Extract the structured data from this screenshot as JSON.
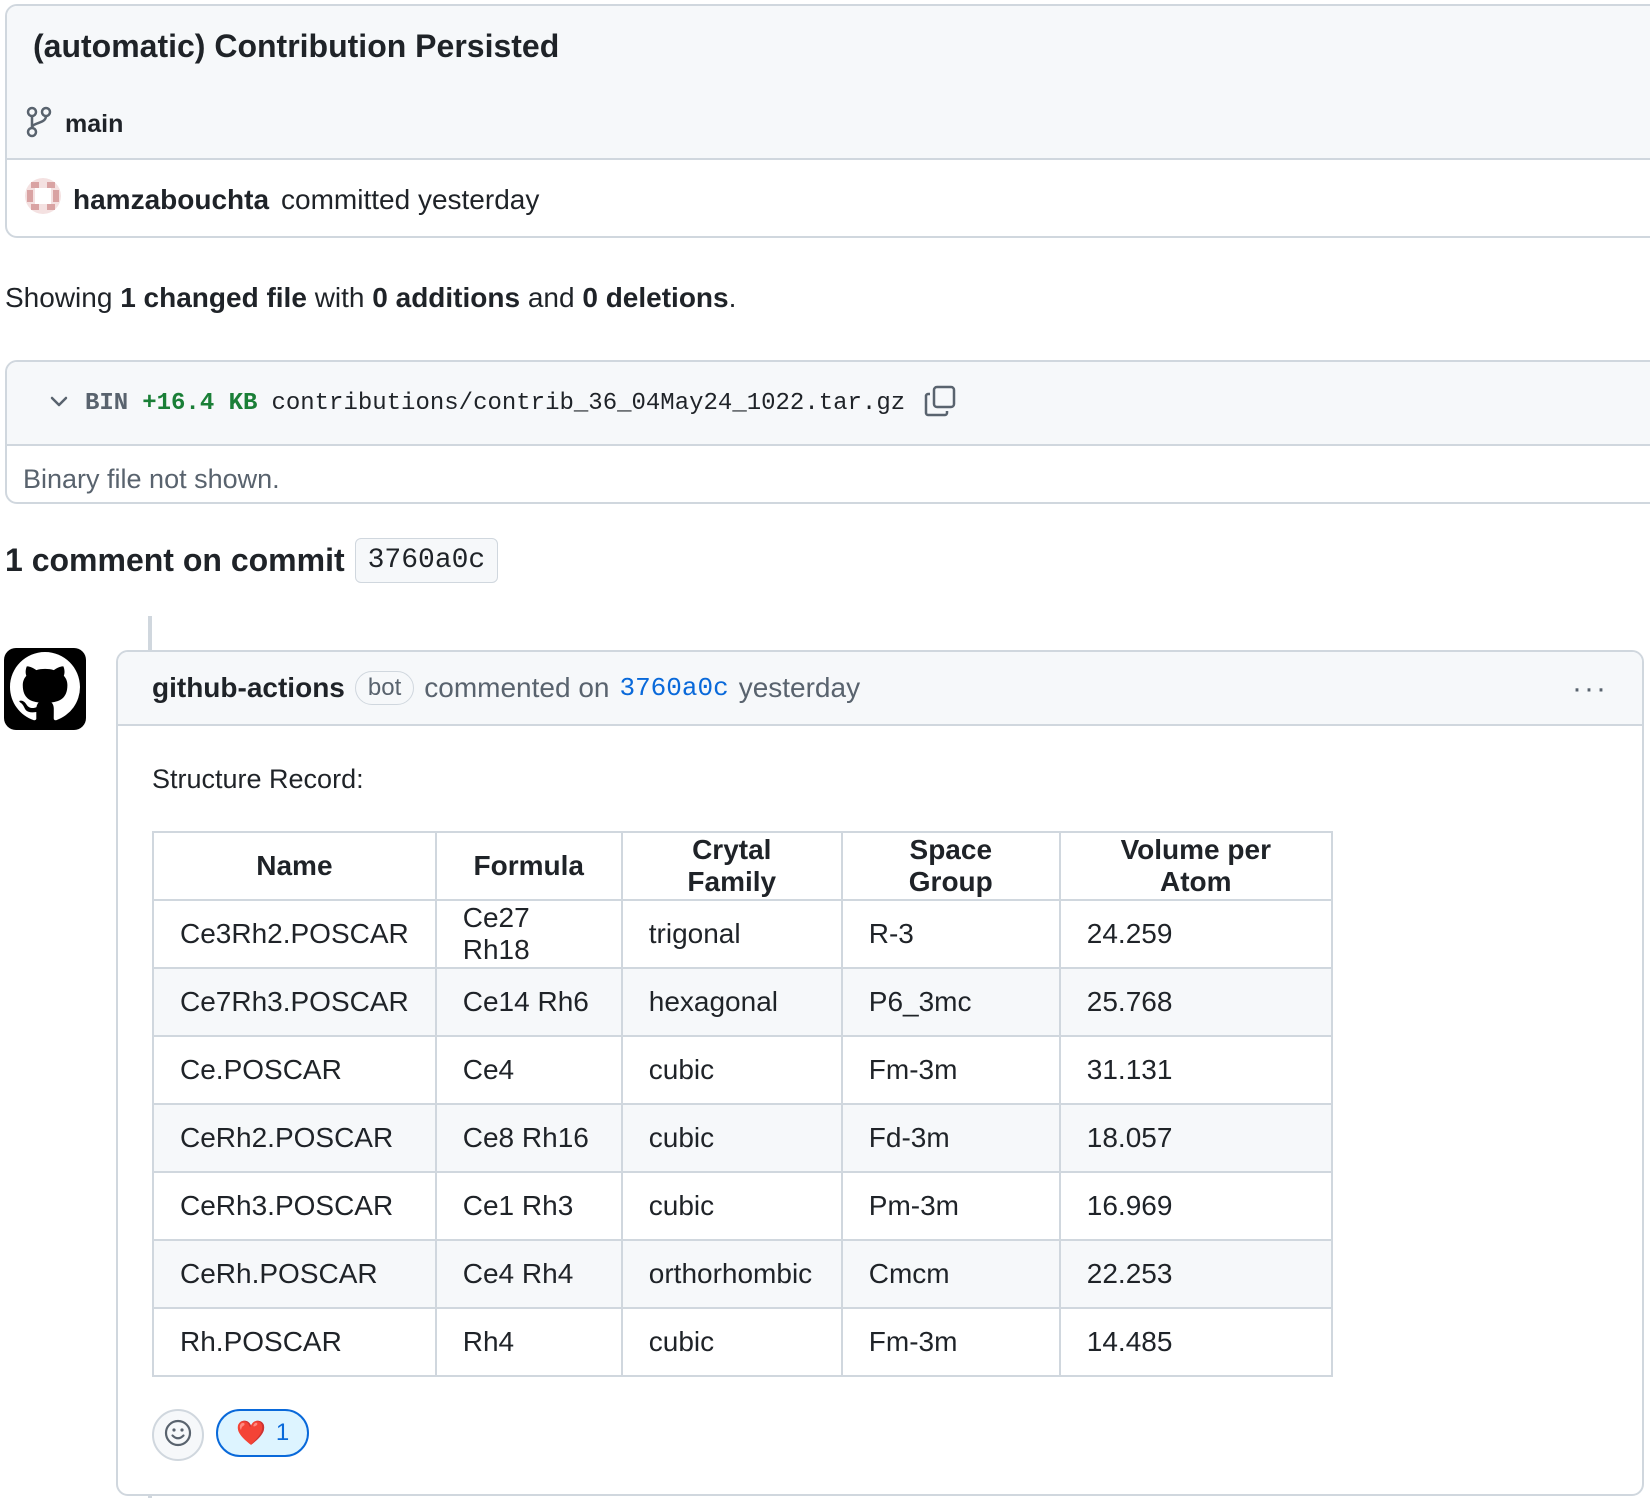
{
  "commit": {
    "title": "(automatic) Contribution Persisted",
    "branch": "main",
    "author": "hamzabouchta",
    "action": "committed yesterday"
  },
  "summary": {
    "prefix": "Showing",
    "files": "1 changed file",
    "with": "with",
    "additions": "0 additions",
    "and": "and",
    "deletions": "0 deletions",
    "end": "."
  },
  "file": {
    "type": "BIN",
    "size": "+16.4 KB",
    "path": "contributions/contrib_36_04May24_1022.tar.gz",
    "body": "Binary file not shown."
  },
  "comments_heading": {
    "text": "1 comment on commit",
    "sha": "3760a0c"
  },
  "comment": {
    "author": "github-actions",
    "badge": "bot",
    "verb": "commented on",
    "sha": "3760a0c",
    "when": "yesterday",
    "more": "···",
    "label": "Structure Record:",
    "table": {
      "headers": [
        "Name",
        "Formula",
        "Crytal Family",
        "Space Group",
        "Volume per Atom"
      ],
      "rows": [
        [
          "Ce3Rh2.POSCAR",
          "Ce27 Rh18",
          "trigonal",
          "R-3",
          "24.259"
        ],
        [
          "Ce7Rh3.POSCAR",
          "Ce14 Rh6",
          "hexagonal",
          "P6_3mc",
          "25.768"
        ],
        [
          "Ce.POSCAR",
          "Ce4",
          "cubic",
          "Fm-3m",
          "31.131"
        ],
        [
          "CeRh2.POSCAR",
          "Ce8 Rh16",
          "cubic",
          "Fd-3m",
          "18.057"
        ],
        [
          "CeRh3.POSCAR",
          "Ce1 Rh3",
          "cubic",
          "Pm-3m",
          "16.969"
        ],
        [
          "CeRh.POSCAR",
          "Ce4 Rh4",
          "orthorhombic",
          "Cmcm",
          "22.253"
        ],
        [
          "Rh.POSCAR",
          "Rh4",
          "cubic",
          "Fm-3m",
          "14.485"
        ]
      ]
    },
    "reactions": {
      "heart_emoji": "❤️",
      "heart_count": "1"
    }
  },
  "colors": {
    "border": "#d0d7de",
    "header_bg": "#f6f8fa",
    "link": "#0969da",
    "addition": "#1a7f37"
  }
}
